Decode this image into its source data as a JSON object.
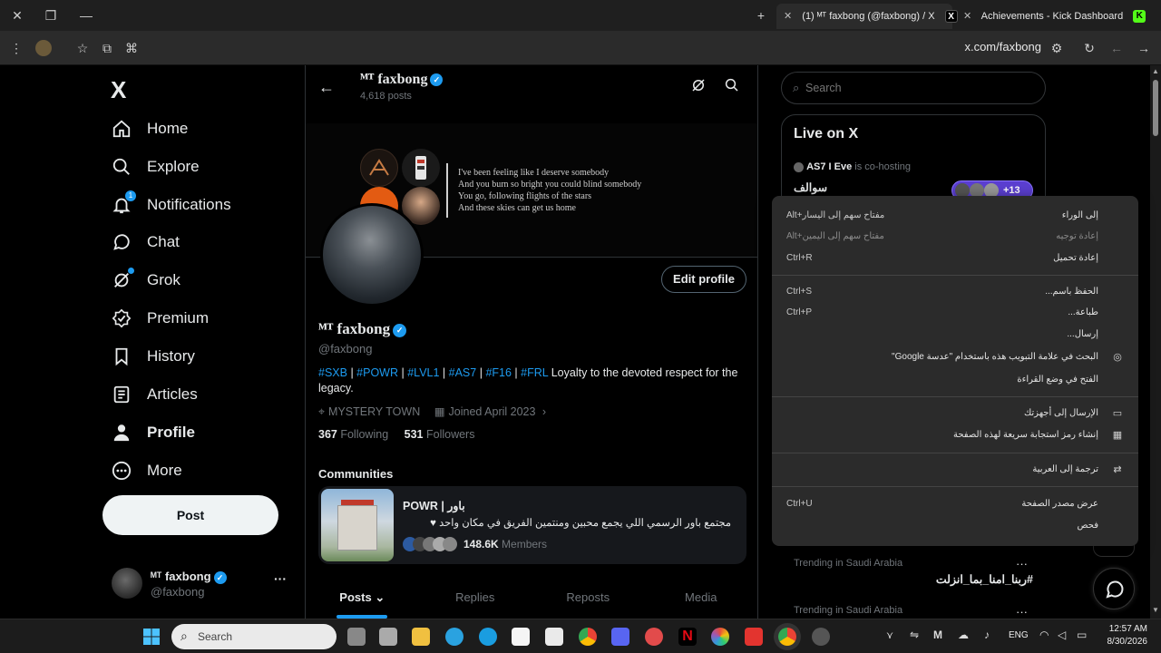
{
  "browser": {
    "tabs": [
      {
        "title": "(1) ᴹᵀ faxbong (@faxbong) / X",
        "active": true
      },
      {
        "title": "Achievements - Kick Dashboard",
        "active": false
      }
    ],
    "url": "x.com/faxbong"
  },
  "logo": "X",
  "nav": {
    "items": [
      {
        "label": "Home",
        "icon": "home-icon"
      },
      {
        "label": "Explore",
        "icon": "search-icon"
      },
      {
        "label": "Notifications",
        "icon": "bell-icon",
        "badge": "1"
      },
      {
        "label": "Chat",
        "icon": "chat-icon"
      },
      {
        "label": "Grok",
        "icon": "grok-icon"
      },
      {
        "label": "Premium",
        "icon": "premium-icon"
      },
      {
        "label": "History",
        "icon": "bookmark-icon"
      },
      {
        "label": "Articles",
        "icon": "articles-icon"
      },
      {
        "label": "Profile",
        "icon": "person-icon"
      },
      {
        "label": "More",
        "icon": "more-icon"
      }
    ],
    "post_label": "Post"
  },
  "account": {
    "name": "ᴹᵀ faxbong",
    "handle": "@faxbong",
    "more": "···"
  },
  "header": {
    "name": "ᴹᵀ faxbong",
    "posts": "4,618 posts"
  },
  "banner": {
    "lyrics": [
      "I've been feeling like I deserve somebody",
      "And you burn so bright you could blind somebody",
      "You go, following flights of the stars",
      "And these skies can get us home"
    ]
  },
  "profile": {
    "edit_label": "Edit profile",
    "name": "ᴹᵀ faxbong",
    "handle": "@faxbong",
    "bio_tags": [
      "#SXB",
      "#POWR",
      "#LVL1",
      "#AS7",
      "#F16",
      "#FRL"
    ],
    "bio_text": "Loyalty to the devoted respect for the legacy.",
    "location": "MYSTERY TOWN",
    "joined": "Joined April 2023",
    "following_count": "367",
    "following_label": "Following",
    "followers_count": "531",
    "followers_label": "Followers"
  },
  "communities": {
    "heading": "Communities",
    "name": "POWR | باور",
    "desc": "مجتمع باور الرسمي اللي يجمع محبين ومنتمين الفريق في مكان واحد ♥",
    "members_count": "148.6K",
    "members_label": "Members"
  },
  "tabs": [
    "Posts",
    "Replies",
    "Reposts",
    "Media"
  ],
  "search": {
    "placeholder": "Search"
  },
  "live": {
    "title": "Live on X",
    "host": "AS7 I Eve",
    "host_suffix": "is co-hosting",
    "space_title": "سوالف",
    "listeners": "+13"
  },
  "trending": [
    {
      "context": "Trending in Saudi Arabia",
      "topic": "#ربنا_امنا_بما_انزلت"
    },
    {
      "context": "Trending in Saudi Arabia",
      "topic": ""
    }
  ],
  "context_menu": {
    "items": [
      {
        "label": "إلى الوراء",
        "shortcut": "Alt+مفتاح سهم إلى اليسار",
        "disabled": false
      },
      {
        "label": "إعادة توجيه",
        "shortcut": "Alt+مفتاح سهم إلى اليمين",
        "disabled": true
      },
      {
        "label": "إعادة تحميل",
        "shortcut": "Ctrl+R",
        "disabled": false
      },
      {
        "label": "الحفظ باسم...",
        "shortcut": "Ctrl+S",
        "disabled": false
      },
      {
        "label": "طباعة...",
        "shortcut": "Ctrl+P",
        "disabled": false
      },
      {
        "label": "إرسال...",
        "shortcut": "",
        "disabled": false
      },
      {
        "label": "البحث في علامة التبويب هذه باستخدام \"عدسة Google\"",
        "shortcut": "",
        "disabled": false,
        "icon": "lens-icon"
      },
      {
        "label": "الفتح في وضع القراءة",
        "shortcut": "",
        "disabled": false
      },
      {
        "label": "الإرسال إلى أجهزتك",
        "shortcut": "",
        "disabled": false,
        "icon": "devices-icon"
      },
      {
        "label": "إنشاء رمز استجابة سريعة لهذه الصفحة",
        "shortcut": "",
        "disabled": false,
        "icon": "qr-icon"
      },
      {
        "label": "ترجمة إلى العربية",
        "shortcut": "",
        "disabled": false,
        "icon": "translate-icon"
      },
      {
        "label": "عرض مصدر الصفحة",
        "shortcut": "Ctrl+U",
        "disabled": false
      },
      {
        "label": "فحص",
        "shortcut": "",
        "disabled": false
      }
    ]
  },
  "taskbar": {
    "search_placeholder": "Search",
    "lang": "ENG",
    "time": "12:57 AM",
    "date": "8/30/2026"
  },
  "colors": {
    "accent": "#1d9bf0",
    "bg": "#000000",
    "border": "#2f3336",
    "muted": "#71767b"
  }
}
